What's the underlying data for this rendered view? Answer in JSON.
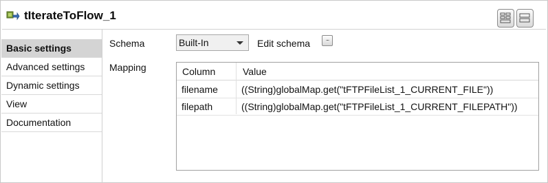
{
  "header": {
    "title": "tIterateToFlow_1",
    "icon": "component-icon",
    "buttons": [
      "layout-grid-icon",
      "layout-rows-icon"
    ]
  },
  "sidebar": {
    "items": [
      {
        "label": "Basic settings",
        "active": true
      },
      {
        "label": "Advanced settings",
        "active": false
      },
      {
        "label": "Dynamic settings",
        "active": false
      },
      {
        "label": "View",
        "active": false
      },
      {
        "label": "Documentation",
        "active": false
      }
    ]
  },
  "schema": {
    "label": "Schema",
    "value": "Built-In",
    "edit_label": "Edit schema",
    "edit_button": "..."
  },
  "mapping": {
    "label": "Mapping",
    "columns": [
      "Column",
      "Value"
    ],
    "rows": [
      {
        "column": "filename",
        "value": "((String)globalMap.get(\"tFTPFileList_1_CURRENT_FILE\"))"
      },
      {
        "column": "filepath",
        "value": "((String)globalMap.get(\"tFTPFileList_1_CURRENT_FILEPATH\"))"
      }
    ]
  },
  "colors": {
    "active_tab_bg": "#d4d4d4",
    "border": "#a0a0a0"
  }
}
